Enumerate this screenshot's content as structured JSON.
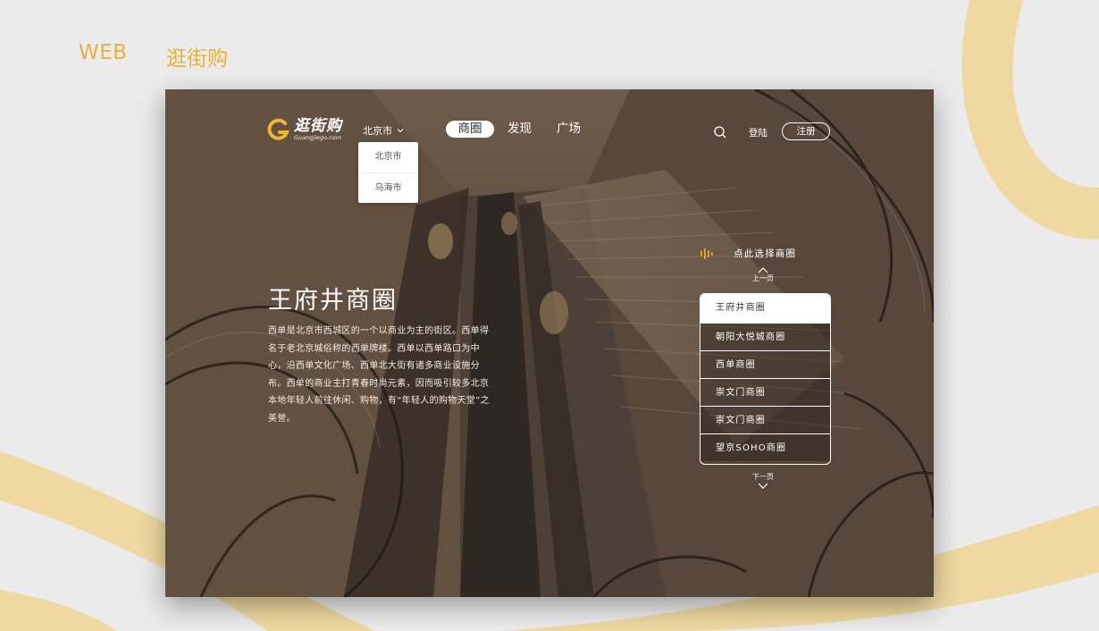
{
  "page_labels": {
    "platform": "WEB",
    "app_name": "逛街购"
  },
  "header": {
    "logo": {
      "name_cn": "逛街购",
      "domain": "Guangjiego.com"
    },
    "city": {
      "selected": "北京市",
      "options": [
        "北京市",
        "乌海市"
      ]
    },
    "nav": [
      "商圈",
      "发现",
      "广场"
    ],
    "login_label": "登陆",
    "register_label": "注册"
  },
  "hero": {
    "title": "王府井商圈",
    "description": "西单是北京市西城区的一个以商业为主的街区。西单得名于老北京城俗称的西单牌楼。西单以西单路口为中心，沿西单文化广场、西单北大街有诸多商业设施分布。西单的商业主打青春时尚元素，因而吸引较多北京本地年轻人前往休闲、购物，有“年轻人的购物天堂”之美誉。"
  },
  "district_picker": {
    "title": "点此选择商圈",
    "prev_label": "上一页",
    "next_label": "下一页",
    "items": [
      "王府井商圈",
      "朝阳大悦城商圈",
      "西单商圈",
      "崇文门商圈",
      "崇文门商圈",
      "望京SOHO商圈"
    ]
  },
  "colors": {
    "accent": "#e7b23a",
    "deco_curve": "#efd9a0"
  }
}
